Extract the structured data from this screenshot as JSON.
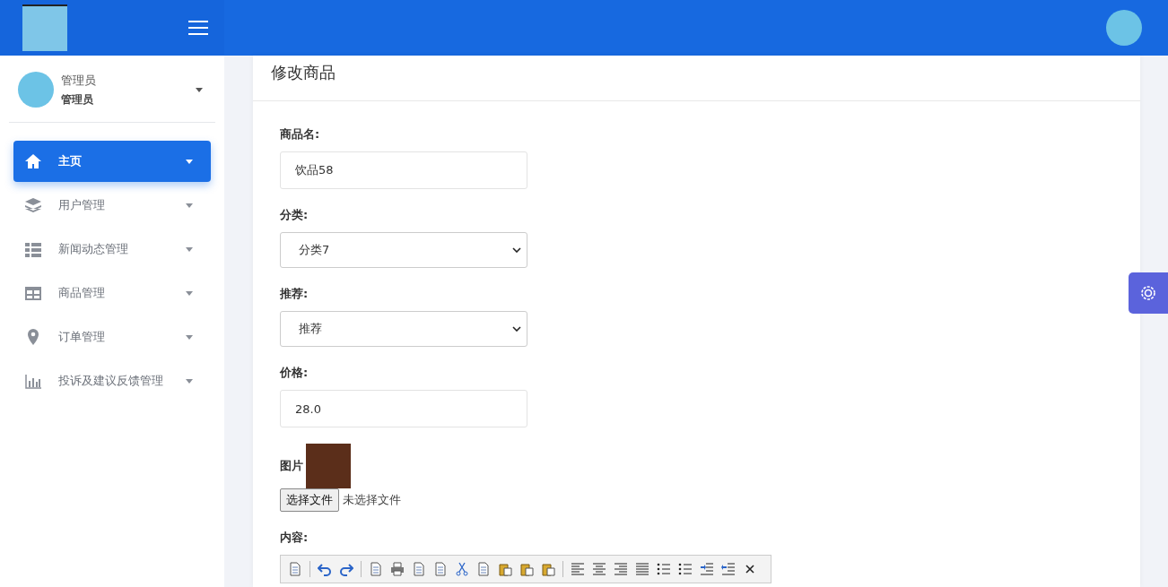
{
  "sidebar": {
    "user": {
      "name": "管理员",
      "role": "管理员"
    },
    "items": [
      {
        "label": "主页",
        "selected": true
      },
      {
        "label": "用户管理",
        "selected": false
      },
      {
        "label": "新闻动态管理",
        "selected": false
      },
      {
        "label": "商品管理",
        "selected": false
      },
      {
        "label": "订单管理",
        "selected": false
      },
      {
        "label": "投诉及建议反馈管理",
        "selected": false
      }
    ]
  },
  "page": {
    "title": "修改商品",
    "fields": [
      {
        "kind": "text",
        "label": "商品名:",
        "value": "饮品58"
      },
      {
        "kind": "select",
        "label": "分类:",
        "value": "分类7"
      },
      {
        "kind": "select",
        "label": "推荐:",
        "value": "推荐"
      },
      {
        "kind": "text",
        "label": "价格:",
        "value": "28.0"
      },
      {
        "kind": "image",
        "label": "图片",
        "button": "选择文件",
        "status": "未选择文件"
      },
      {
        "kind": "editor",
        "label": "内容:"
      }
    ]
  }
}
